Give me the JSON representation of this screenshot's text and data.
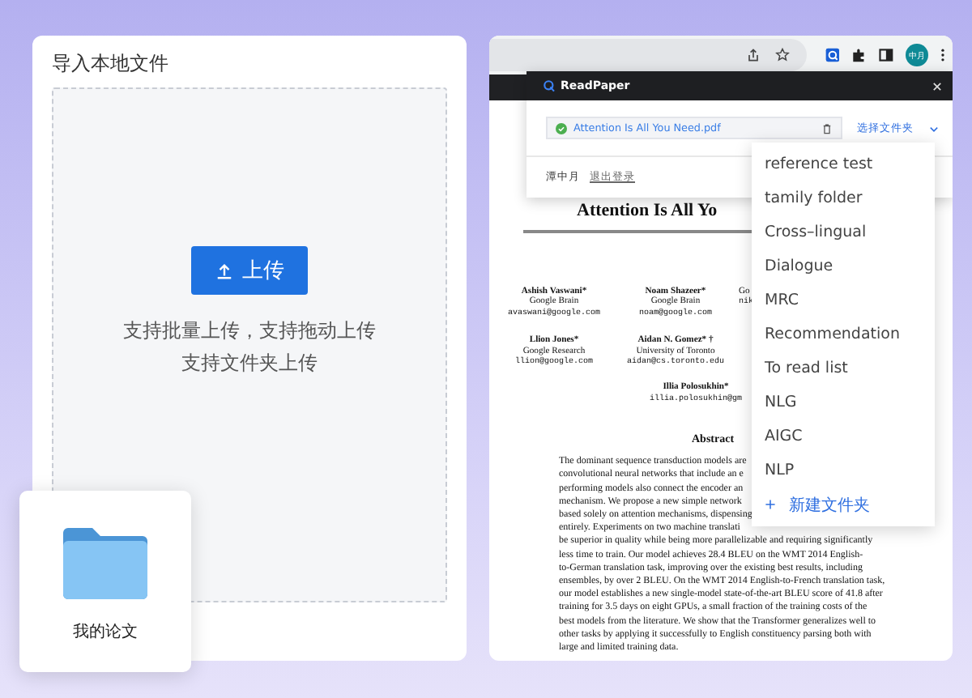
{
  "import_panel": {
    "title": "导入本地文件",
    "upload_button": "上传",
    "hints": [
      "支持批量上传，支持拖动上传",
      "支持文件夹上传"
    ],
    "folder": {
      "name": "我的论文"
    }
  },
  "browser": {
    "avatar": "中月"
  },
  "extension_popup": {
    "brand": "ReadPaper",
    "file_name": "Attention Is All You Need.pdf",
    "folder_select": "选择文件夹",
    "user": "潭中月",
    "logout": "退出登录"
  },
  "paper": {
    "title": "Attention Is All Yo",
    "author_rows": [
      [
        {
          "name": "Ashish Vaswani*",
          "affiliation": "Google Brain",
          "email": "avaswani@google.com"
        },
        {
          "name": "Noam Shazeer*",
          "affiliation": "Google Brain",
          "email": "noam@google.com"
        },
        {
          "affiliation": "Go",
          "email": "nik"
        }
      ],
      [
        {
          "name": "Llion Jones*",
          "affiliation": "Google Research",
          "email": "llion@google.com"
        },
        {
          "name": "Aidan N. Gomez* †",
          "affiliation": "University of Toronto",
          "email": "aidan@cs.toronto.edu"
        }
      ],
      [
        {
          "name": "Illia Polosukhin*",
          "email": "illia.polosukhin@gm"
        }
      ]
    ],
    "abstract_heading": "Abstract",
    "abstract_lines": [
      "The dominant sequence transduction models are",
      "convolutional neural networks that include an e",
      "performing models also connect the encoder an",
      "mechanism. We propose a new simple network",
      "based solely on attention mechanisms, dispensing",
      "entirely. Experiments on two machine translati",
      "be superior in quality while being more parallelizable and requiring significantly",
      "less time to train. Our model achieves 28.4 BLEU on the WMT 2014 English-",
      "to-German translation task, improving over the existing best results, including",
      "ensembles, by over 2 BLEU. On the WMT 2014 English-to-French translation task,",
      "our model establishes a new single-model state-of-the-art BLEU score of 41.8 after",
      "training for 3.5 days on eight GPUs, a small fraction of the training costs of the",
      "best models from the literature. We show that the Transformer generalizes well to",
      "other tasks by applying it successfully to English constituency parsing both with",
      "large and limited training data."
    ]
  },
  "folder_menu": {
    "items": [
      {
        "label": "reference test"
      },
      {
        "label": "tamily folder"
      },
      {
        "label": "Cross–lingual"
      },
      {
        "label": "Dialogue"
      },
      {
        "label": "MRC"
      },
      {
        "label": "Recommendation"
      },
      {
        "label": "To read list"
      },
      {
        "label": "NLG"
      },
      {
        "label": "AIGC"
      },
      {
        "label": "NLP"
      }
    ],
    "new_folder": "新建文件夹"
  }
}
